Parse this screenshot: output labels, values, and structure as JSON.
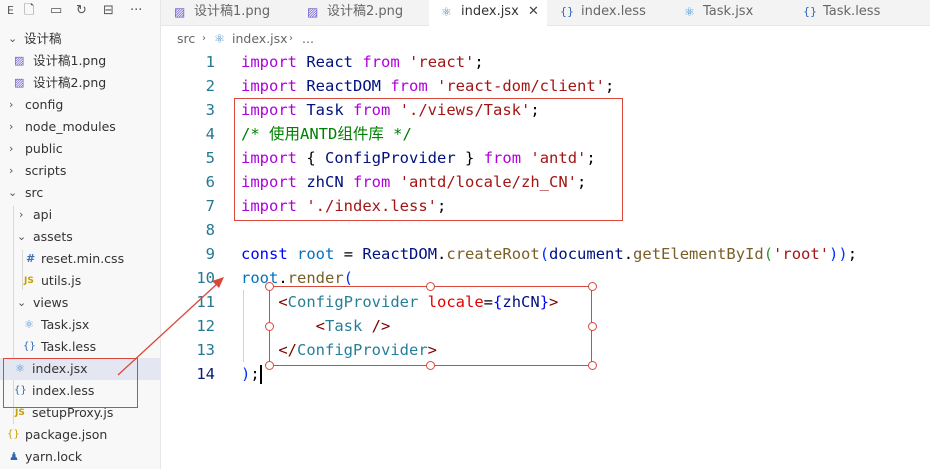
{
  "sidebar": {
    "toolbar_icons": [
      "explorer-label-icon",
      "new-file-icon",
      "new-folder-icon",
      "refresh-icon",
      "collapse-all-icon",
      "more-icon"
    ],
    "items": [
      {
        "label": "设计稿",
        "type": "folder-open"
      },
      {
        "label": "设计稿1.png",
        "type": "image"
      },
      {
        "label": "设计稿2.png",
        "type": "image"
      },
      {
        "label": "config",
        "type": "folder"
      },
      {
        "label": "node_modules",
        "type": "folder"
      },
      {
        "label": "public",
        "type": "folder"
      },
      {
        "label": "scripts",
        "type": "folder"
      },
      {
        "label": "src",
        "type": "folder-open"
      },
      {
        "label": "api",
        "type": "folder"
      },
      {
        "label": "assets",
        "type": "folder-open"
      },
      {
        "label": "reset.min.css",
        "type": "css"
      },
      {
        "label": "utils.js",
        "type": "js"
      },
      {
        "label": "views",
        "type": "folder-open"
      },
      {
        "label": "Task.jsx",
        "type": "react"
      },
      {
        "label": "Task.less",
        "type": "less"
      },
      {
        "label": "index.jsx",
        "type": "react"
      },
      {
        "label": "index.less",
        "type": "less"
      },
      {
        "label": "setupProxy.js",
        "type": "js"
      },
      {
        "label": "package.json",
        "type": "json"
      },
      {
        "label": "yarn.lock",
        "type": "lock"
      }
    ]
  },
  "tabs": [
    {
      "label": "设计稿1.png",
      "icon": "image-icon"
    },
    {
      "label": "设计稿2.png",
      "icon": "image-icon"
    },
    {
      "label": "index.jsx",
      "icon": "react-icon",
      "active": true
    },
    {
      "label": "index.less",
      "icon": "braces-icon"
    },
    {
      "label": "Task.jsx",
      "icon": "react-icon"
    },
    {
      "label": "Task.less",
      "icon": "braces-icon"
    }
  ],
  "breadcrumb": {
    "root": "src",
    "file": "index.jsx",
    "more": "..."
  },
  "line_numbers": [
    "1",
    "2",
    "3",
    "4",
    "5",
    "6",
    "7",
    "8",
    "9",
    "10",
    "11",
    "12",
    "13",
    "14"
  ],
  "code": {
    "l1": {
      "kw": "import",
      "id": "React",
      "from": "from",
      "str": "'react'",
      "end": ";"
    },
    "l2": {
      "kw": "import",
      "id": "ReactDOM",
      "from": "from",
      "str": "'react-dom/client'",
      "end": ";"
    },
    "l3": {
      "kw": "import",
      "id": "Task",
      "from": "from",
      "str": "'./views/Task'",
      "end": ";"
    },
    "l4": {
      "comment": "/* 使用ANTD组件库 */"
    },
    "l5": {
      "kw": "import",
      "open": "{",
      "id": "ConfigProvider",
      "close": "}",
      "from": "from",
      "str": "'antd'",
      "end": ";"
    },
    "l6": {
      "kw": "import",
      "id": "zhCN",
      "from": "from",
      "str": "'antd/locale/zh_CN'",
      "end": ";"
    },
    "l7": {
      "kw": "import",
      "str": "'./index.less'",
      "end": ";"
    },
    "l9": {
      "kw": "const",
      "id": "root",
      "eq": "=",
      "obj": "ReactDOM",
      "dot": ".",
      "fn": "createRoot",
      "p1": "(",
      "arg_obj": "document",
      "dot2": ".",
      "fn2": "getElementById",
      "p2": "(",
      "str": "'root'",
      "p3": "))",
      "end": ";"
    },
    "l10": {
      "id": "root",
      "dot": ".",
      "fn": "render",
      "p": "("
    },
    "l11": {
      "lt": "<",
      "tag": "ConfigProvider",
      "attr": "locale",
      "eq": "=",
      "ob": "{",
      "val": "zhCN",
      "cb": "}",
      "gt": ">"
    },
    "l12": {
      "lt": "<",
      "tag": "Task",
      "end": "/>"
    },
    "l13": {
      "lt": "</",
      "tag": "ConfigProvider",
      "gt": ">"
    },
    "l14": {
      "p": ")",
      "end": ";"
    }
  },
  "annotation_color": "#d9483b"
}
